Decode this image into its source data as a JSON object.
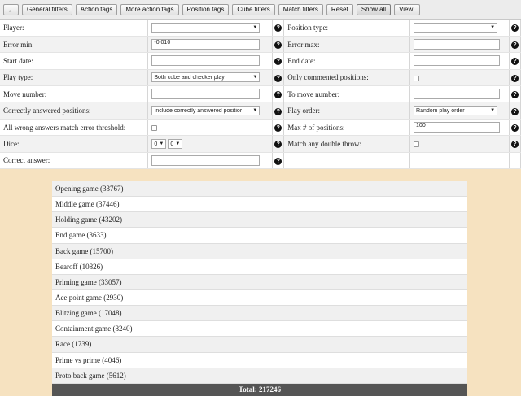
{
  "toolbar": {
    "back_icon": "arrow-left-icon",
    "buttons": [
      {
        "label": "General filters"
      },
      {
        "label": "Action tags"
      },
      {
        "label": "More action tags"
      },
      {
        "label": "Position tags"
      },
      {
        "label": "Cube filters"
      },
      {
        "label": "Match filters"
      },
      {
        "label": "Reset"
      },
      {
        "label": "Show all"
      },
      {
        "label": "View!"
      }
    ]
  },
  "filters": {
    "player": {
      "label": "Player:",
      "value": ""
    },
    "position_type": {
      "label": "Position type:",
      "value": ""
    },
    "error_min": {
      "label": "Error min:",
      "value": "-0.010"
    },
    "error_max": {
      "label": "Error max:",
      "value": ""
    },
    "start_date": {
      "label": "Start date:",
      "value": ""
    },
    "end_date": {
      "label": "End date:",
      "value": ""
    },
    "play_type": {
      "label": "Play type:",
      "value": "Both cube and checker play"
    },
    "only_commented": {
      "label": "Only commented positions:",
      "checked": false
    },
    "move_number": {
      "label": "Move number:",
      "value": ""
    },
    "to_move_number": {
      "label": "To move number:",
      "value": ""
    },
    "correctly_answered": {
      "label": "Correctly answered positions:",
      "value": "Include correctly answered positior"
    },
    "play_order": {
      "label": "Play order:",
      "value": "Random play order"
    },
    "all_wrong": {
      "label": "All wrong answers match error threshold:",
      "checked": false
    },
    "max_positions": {
      "label": "Max # of positions:",
      "value": "100"
    },
    "dice": {
      "label": "Dice:",
      "die1": "0",
      "die2": "0"
    },
    "match_double": {
      "label": "Match any double throw:",
      "checked": false
    },
    "correct_answer": {
      "label": "Correct answer:",
      "value": ""
    }
  },
  "position_tags": [
    "Opening game (33767)",
    "Middle game (37446)",
    "Holding game (43202)",
    "End game (3633)",
    "Back game (15700)",
    "Bearoff (10826)",
    "Priming game (33057)",
    "Ace point game (2930)",
    "Blitzing game (17048)",
    "Containment game (8240)",
    "Race (1739)",
    "Prime vs prime (4046)",
    "Proto back game (5612)"
  ],
  "total": "Total: 217246",
  "help_icon": "question-circle-icon"
}
